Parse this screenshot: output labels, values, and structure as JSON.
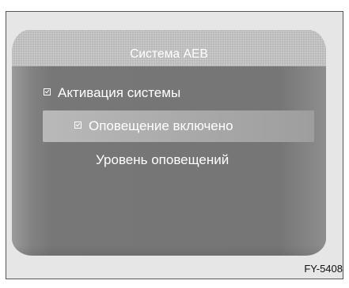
{
  "screen": {
    "title": "Система AEB"
  },
  "menu": {
    "items": [
      {
        "label": "Активация системы",
        "checked": true,
        "selected": false
      },
      {
        "label": "Оповещение включено",
        "checked": true,
        "selected": true
      },
      {
        "label": "Уровень оповещений",
        "checked": false,
        "selected": false
      }
    ]
  },
  "figure_code": "FY-5408",
  "colors": {
    "header": "#b9b9b9",
    "body": "#7a7a7a",
    "highlight": "#aeaeae",
    "text": "#ffffff"
  }
}
